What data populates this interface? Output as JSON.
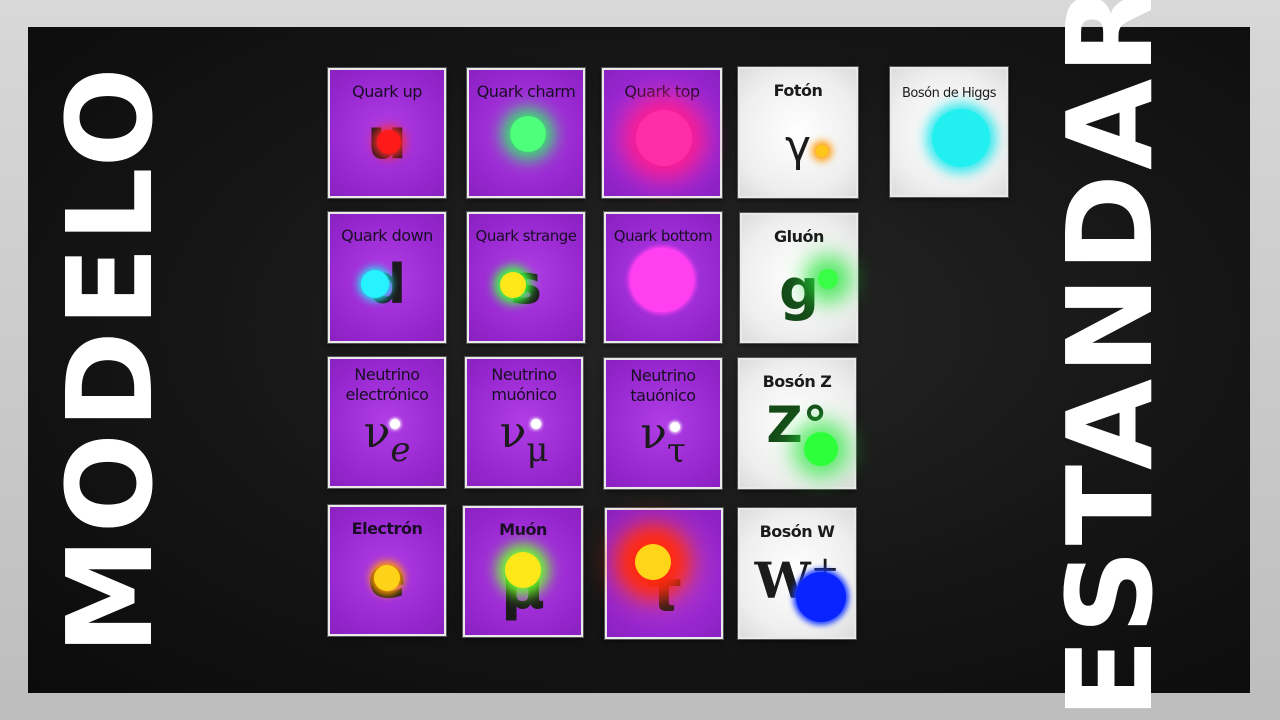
{
  "title_left": "MODELO",
  "title_right": "ESTANDAR",
  "cards": {
    "quark_up": {
      "label": "Quark up",
      "symbol": "u"
    },
    "quark_charm": {
      "label": "Quark charm",
      "symbol": ""
    },
    "quark_top": {
      "label": "Quark top",
      "symbol": ""
    },
    "foton": {
      "label": "Fotón",
      "symbol": "γ"
    },
    "boson_higgs": {
      "label": "Bosón de Higgs",
      "symbol": ""
    },
    "quark_down": {
      "label": "Quark down",
      "symbol": "d"
    },
    "quark_strange": {
      "label": "Quark strange",
      "symbol": "s"
    },
    "quark_bottom": {
      "label": "Quark bottom",
      "symbol": ""
    },
    "gluon": {
      "label": "Gluón",
      "symbol": "g"
    },
    "neutrino_e": {
      "label": "Neutrino electrónico",
      "symbol": "ν",
      "sub": "e"
    },
    "neutrino_mu": {
      "label": "Neutrino muónico",
      "symbol": "ν",
      "sub": "μ"
    },
    "neutrino_tau": {
      "label": "Neutrino tauónico",
      "symbol": "ν",
      "sub": "τ"
    },
    "boson_z": {
      "label": "Bosón Z",
      "symbol": "Z°"
    },
    "electron": {
      "label": "Electrón",
      "symbol": "e"
    },
    "muon": {
      "label": "Muón",
      "symbol": "μ"
    },
    "tau": {
      "label": "",
      "symbol": "τ"
    },
    "boson_w": {
      "label": "Bosón W",
      "symbol": "W",
      "sup": "+"
    }
  },
  "colors": {
    "card_purple": "#9a2ad3",
    "card_white": "#eeeeee",
    "glow_red": "#ff2020",
    "glow_green": "#3dff6a",
    "glow_pink": "#ff2ab0",
    "glow_magenta": "#ff34f0",
    "glow_cyan": "#2ef2f2",
    "glow_yellow": "#ffe81a",
    "glow_orange": "#ff6a00",
    "glow_blue": "#0a2cff",
    "glow_white": "#ffffff"
  }
}
